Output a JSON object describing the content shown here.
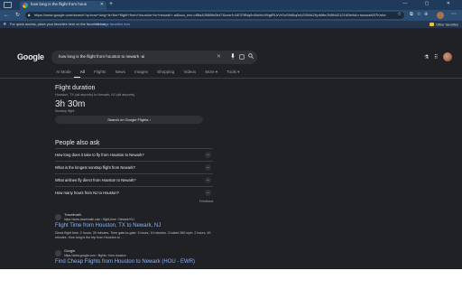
{
  "browser": {
    "tab_title": "how long is the flight from hous",
    "url": "https://www.google.com/search?q=how+long+is+the+flight+from+houston+to+newark+-ai&sca_esv=df8a42588fb2b47&sxsrf=AE3TifNq9oNsHsVWgtRUrVrSuS9d5q0r&GSMA2KpMtbr2N5N4212190kfhd=rnwouaM37Knbe9yPpqd3Qs&ved=...",
    "window_controls": "— ▢ ✕"
  },
  "favorites_bar": {
    "prompt": "For quick access, place your favorites here on the favorites bar.",
    "link": "Manage favorites now",
    "other": "Other favorites"
  },
  "google": {
    "logo": "Google",
    "query": "how long is the flight from houston to newark -ai",
    "tabs": [
      "AI Mode",
      "All",
      "Flights",
      "News",
      "Images",
      "Shopping",
      "Videos",
      "More ▾",
      "Tools ▾"
    ]
  },
  "flight": {
    "title": "Flight duration",
    "route": "Houston, TX (all airports) to Newark, NJ (all airports)",
    "duration": "3h 30m",
    "sub": "Nonstop flight",
    "button": "Search on Google Flights ›"
  },
  "paa": {
    "title": "People also ask",
    "questions": [
      "How long does it take to fly from Houston to Newark?",
      "What is the longest nonstop flight from Newark?",
      "What airlines fly direct from Houston to Newark?",
      "How many hours from NJ to Houston?"
    ],
    "feedback": "Feedback"
  },
  "results": [
    {
      "site": "Travelmath",
      "url": "https://www.travelmath.com › flight-time › Newark+NJ",
      "title": "Flight Time from Houston, TX to Newark, NJ",
      "snippet": "Direct flight time: 2 hours, 39 minutes. Time gate-to-gate: 3 hours, 10 minutes. Cruised 360 mph: 2 hours, 49 minutes. How long is the trip from Houston to ..."
    },
    {
      "site": "Google",
      "url": "https://www.google.com › flights › from-houston",
      "title": "Find Cheap Flights from Houston to Newark (HOU - EWR)"
    }
  ]
}
